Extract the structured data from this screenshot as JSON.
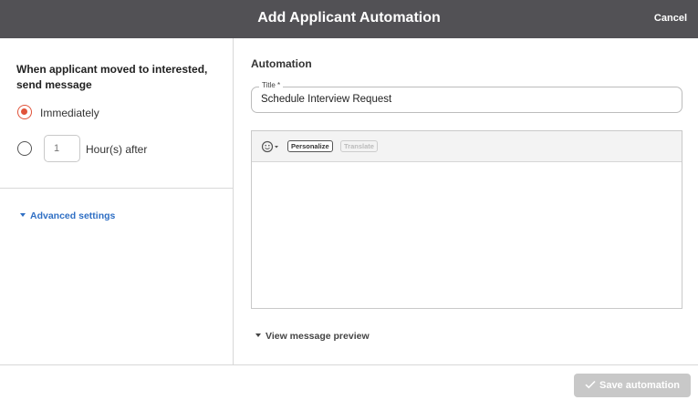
{
  "header": {
    "title": "Add Applicant Automation",
    "cancel_label": "Cancel"
  },
  "trigger": {
    "text": "When applicant moved to interested, send message",
    "options": [
      {
        "label": "Immediately",
        "selected": true
      },
      {
        "label": "Hour(s) after",
        "selected": false
      }
    ],
    "hours_placeholder": "1",
    "hours_value": ""
  },
  "advanced": {
    "label": "Advanced settings",
    "icon": "caret-down-icon"
  },
  "automation": {
    "section_title": "Automation",
    "title_label": "Title *",
    "title_value": "Schedule Interview Request"
  },
  "editor": {
    "emoji_icon": "emoji-smile-icon",
    "personalize_label": "Personalize",
    "translate_label": "Translate",
    "message_value": ""
  },
  "preview": {
    "label": "View message preview"
  },
  "footer": {
    "save_label": "Save automation",
    "save_icon": "check-icon"
  },
  "colors": {
    "header_bg": "#525155",
    "radio_accent": "#e0533a",
    "link_blue": "#2f6fc4",
    "disabled_button": "#c8c8c8"
  }
}
